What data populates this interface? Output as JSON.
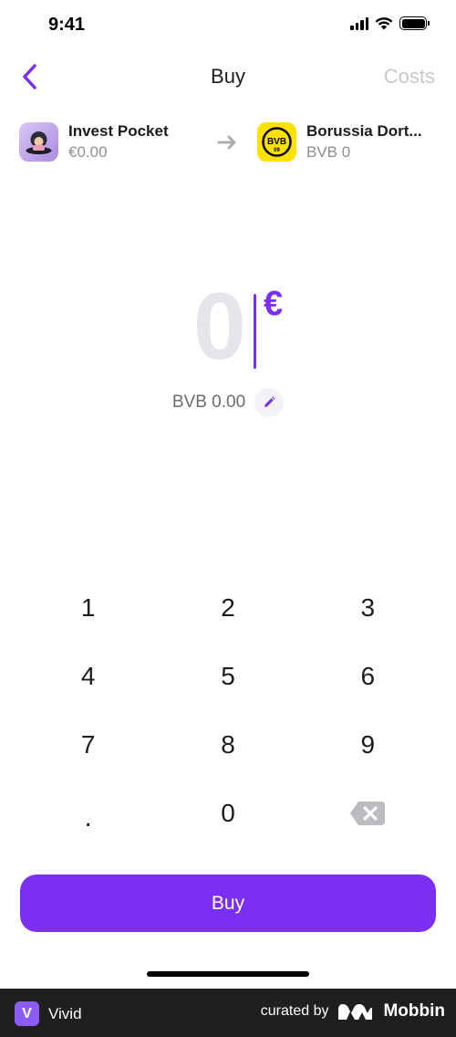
{
  "status_bar": {
    "time": "9:41"
  },
  "nav": {
    "title": "Buy",
    "costs_label": "Costs"
  },
  "from_pocket": {
    "name": "Invest Pocket",
    "balance": "€0.00"
  },
  "to_pocket": {
    "name": "Borussia Dort...",
    "balance": "BVB 0",
    "logo_text": "BVB",
    "logo_number": "09"
  },
  "amount": {
    "value": "0",
    "currency": "€",
    "conversion": "BVB 0.00"
  },
  "keypad": {
    "keys": [
      "1",
      "2",
      "3",
      "4",
      "5",
      "6",
      "7",
      "8",
      "9",
      ".",
      "0"
    ]
  },
  "buy_button": {
    "label": "Buy"
  },
  "footer": {
    "brand_letter": "V",
    "brand_name": "Vivid",
    "credit": "curated by",
    "provider": "Mobbin"
  },
  "colors": {
    "accent": "#7b2ff2",
    "muted": "#c7c7cc",
    "footer_bg": "#1f1f1f"
  }
}
